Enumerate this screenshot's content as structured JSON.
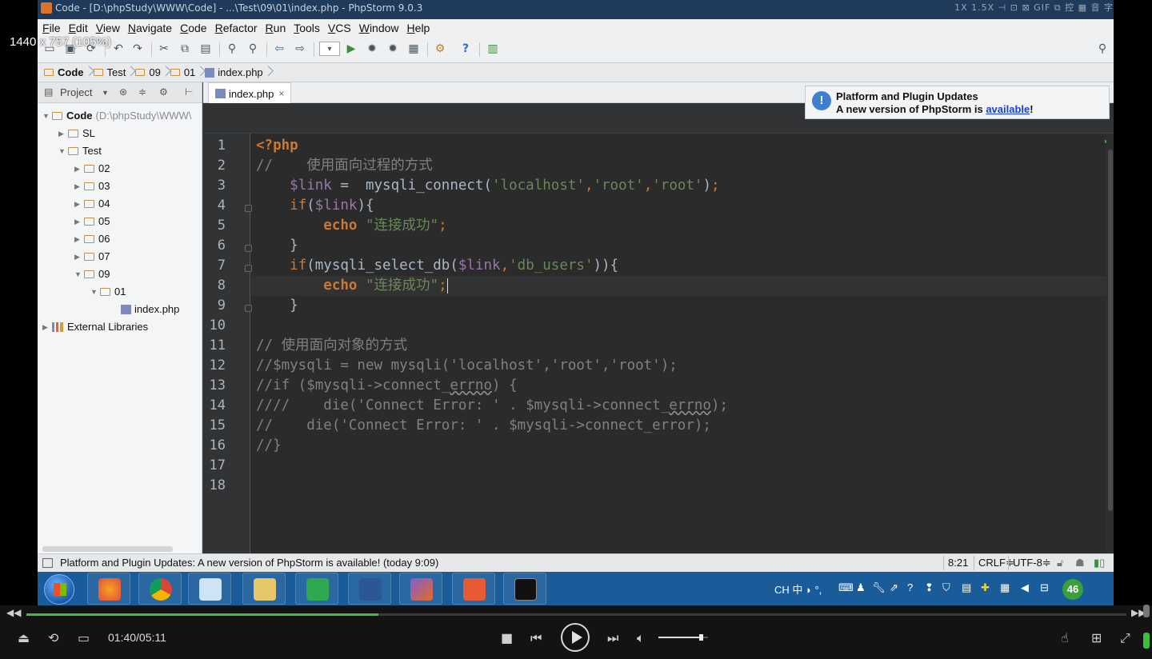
{
  "window": {
    "title": "Code - [D:\\phpStudy\\WWW\\Code] - ...\\Test\\09\\01\\index.php - PhpStorm 9.0.3",
    "right_controls": "1X  1.5X  ⊣  ⊡  ⊠  GIF  ⧉  控  ▦  音  字"
  },
  "overlay_size_label": "1440 x 757 (105%)",
  "menu": [
    "File",
    "Edit",
    "View",
    "Navigate",
    "Code",
    "Refactor",
    "Run",
    "Tools",
    "VCS",
    "Window",
    "Help"
  ],
  "breadcrumb": [
    {
      "label": "Code",
      "icon": "folder-icon"
    },
    {
      "label": "Test",
      "icon": "folder-icon"
    },
    {
      "label": "09",
      "icon": "folder-icon"
    },
    {
      "label": "01",
      "icon": "folder-icon"
    },
    {
      "label": "index.php",
      "icon": "php-file-icon"
    }
  ],
  "project_panel": {
    "title": "Project",
    "tree": [
      {
        "label": "Code",
        "extra": "(D:\\phpStudy\\WWW\\",
        "bold": true,
        "expanded": true
      },
      {
        "label": "SL",
        "expanded": false
      },
      {
        "label": "Test",
        "expanded": true
      },
      {
        "label": "02",
        "expanded": false
      },
      {
        "label": "03",
        "expanded": false
      },
      {
        "label": "04",
        "expanded": false
      },
      {
        "label": "05",
        "expanded": false
      },
      {
        "label": "06",
        "expanded": false
      },
      {
        "label": "07",
        "expanded": false
      },
      {
        "label": "09",
        "expanded": true
      },
      {
        "label": "01",
        "expanded": true
      },
      {
        "label": "index.php",
        "file": true
      },
      {
        "label": "External Libraries",
        "expanded": false,
        "library": true
      }
    ]
  },
  "editor": {
    "tab_label": "index.php",
    "tab_close": "×",
    "line_numbers": [
      "1",
      "2",
      "3",
      "4",
      "5",
      "6",
      "7",
      "8",
      "9",
      "10",
      "11",
      "12",
      "13",
      "14",
      "15",
      "16",
      "17",
      "18"
    ],
    "current_line": 8
  },
  "notification": {
    "title": "Platform and Plugin Updates",
    "text_before": "A new version of PhpStorm is ",
    "link": "available",
    "text_after": "!"
  },
  "statusbar": {
    "message": "Platform and Plugin Updates: A new version of PhpStorm is available! (today 9:09)",
    "position": "8:21",
    "line_sep": "CRLF≑",
    "encoding": "UTF-8≑"
  },
  "taskbar": {
    "tray_text": "CH 中 ◗ °,",
    "badge": "46"
  },
  "player": {
    "time": "01:40/05:11",
    "progress": 0.32,
    "volume": 0.85
  },
  "colors": {
    "keyword": "#cc7832",
    "string": "#6a8759",
    "variable": "#9876aa",
    "comment": "#808080",
    "editor_bg": "#2b2b2b",
    "seek_fill": "#3cc03c"
  }
}
